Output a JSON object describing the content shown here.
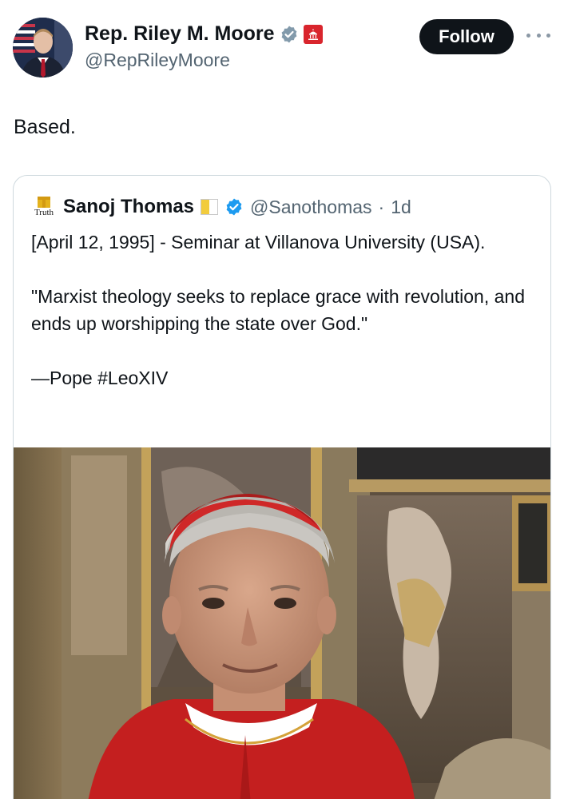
{
  "post": {
    "author_name": "Rep. Riley M. Moore",
    "author_handle": "@RepRileyMoore",
    "follow_label": "Follow",
    "text": "Based."
  },
  "quote": {
    "author_name": "Sanoj Thomas",
    "avatar_text": "Truth",
    "author_handle": "@Sanothomas",
    "separator": "·",
    "time": "1d",
    "line1": "[April 12, 1995] - Seminar at Villanova University (USA).",
    "line2": "\"Marxist theology seeks to replace grace with revolution, and ends up worshipping the state over God.\"",
    "line3": "—Pope #LeoXIV"
  },
  "colors": {
    "text_primary": "#0f1419",
    "text_secondary": "#536471",
    "verified_blue": "#1d9bf0",
    "verified_grey": "#829aab",
    "follow_bg": "#0f1419",
    "card_border": "#cfd9de",
    "gov_red": "#d9252d"
  },
  "icons": {
    "grey_check": "verified-grey-icon",
    "blue_check": "verified-blue-icon",
    "gov_badge": "capitol-badge-icon",
    "more": "more-dots-icon"
  }
}
